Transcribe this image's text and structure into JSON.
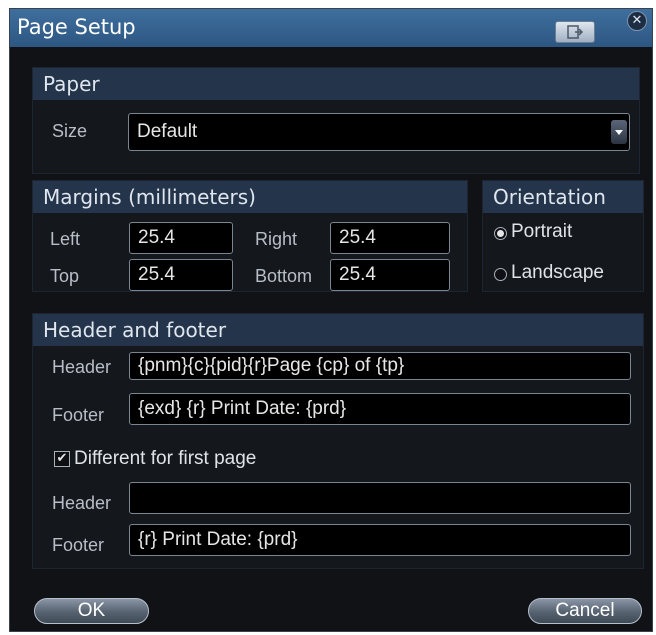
{
  "window": {
    "title": "Page Setup"
  },
  "paper": {
    "header": "Paper",
    "size_label": "Size",
    "size_value": "Default"
  },
  "margins": {
    "header": "Margins (millimeters)",
    "left_label": "Left",
    "left_value": "25.4",
    "right_label": "Right",
    "right_value": "25.4",
    "top_label": "Top",
    "top_value": "25.4",
    "bottom_label": "Bottom",
    "bottom_value": "25.4"
  },
  "orientation": {
    "header": "Orientation",
    "portrait_label": "Portrait",
    "portrait_selected": true,
    "landscape_label": "Landscape",
    "landscape_selected": false
  },
  "header_footer": {
    "header": "Header and footer",
    "header_label": "Header",
    "header_value": "{pnm}{c}{pid}{r}Page {cp} of {tp}",
    "footer_label": "Footer",
    "footer_value": "{exd} {r} Print Date: {prd}",
    "different_first_label": "Different for first page",
    "different_first_checked": true,
    "first_header_label": "Header",
    "first_header_value": "",
    "first_footer_label": "Footer",
    "first_footer_value": "{r} Print Date: {prd}"
  },
  "buttons": {
    "ok": "OK",
    "cancel": "Cancel"
  },
  "icons": {
    "restore": "window-restore-icon",
    "close": "close-icon",
    "dropdown": "chevron-down-icon",
    "check": "checkmark-icon"
  }
}
